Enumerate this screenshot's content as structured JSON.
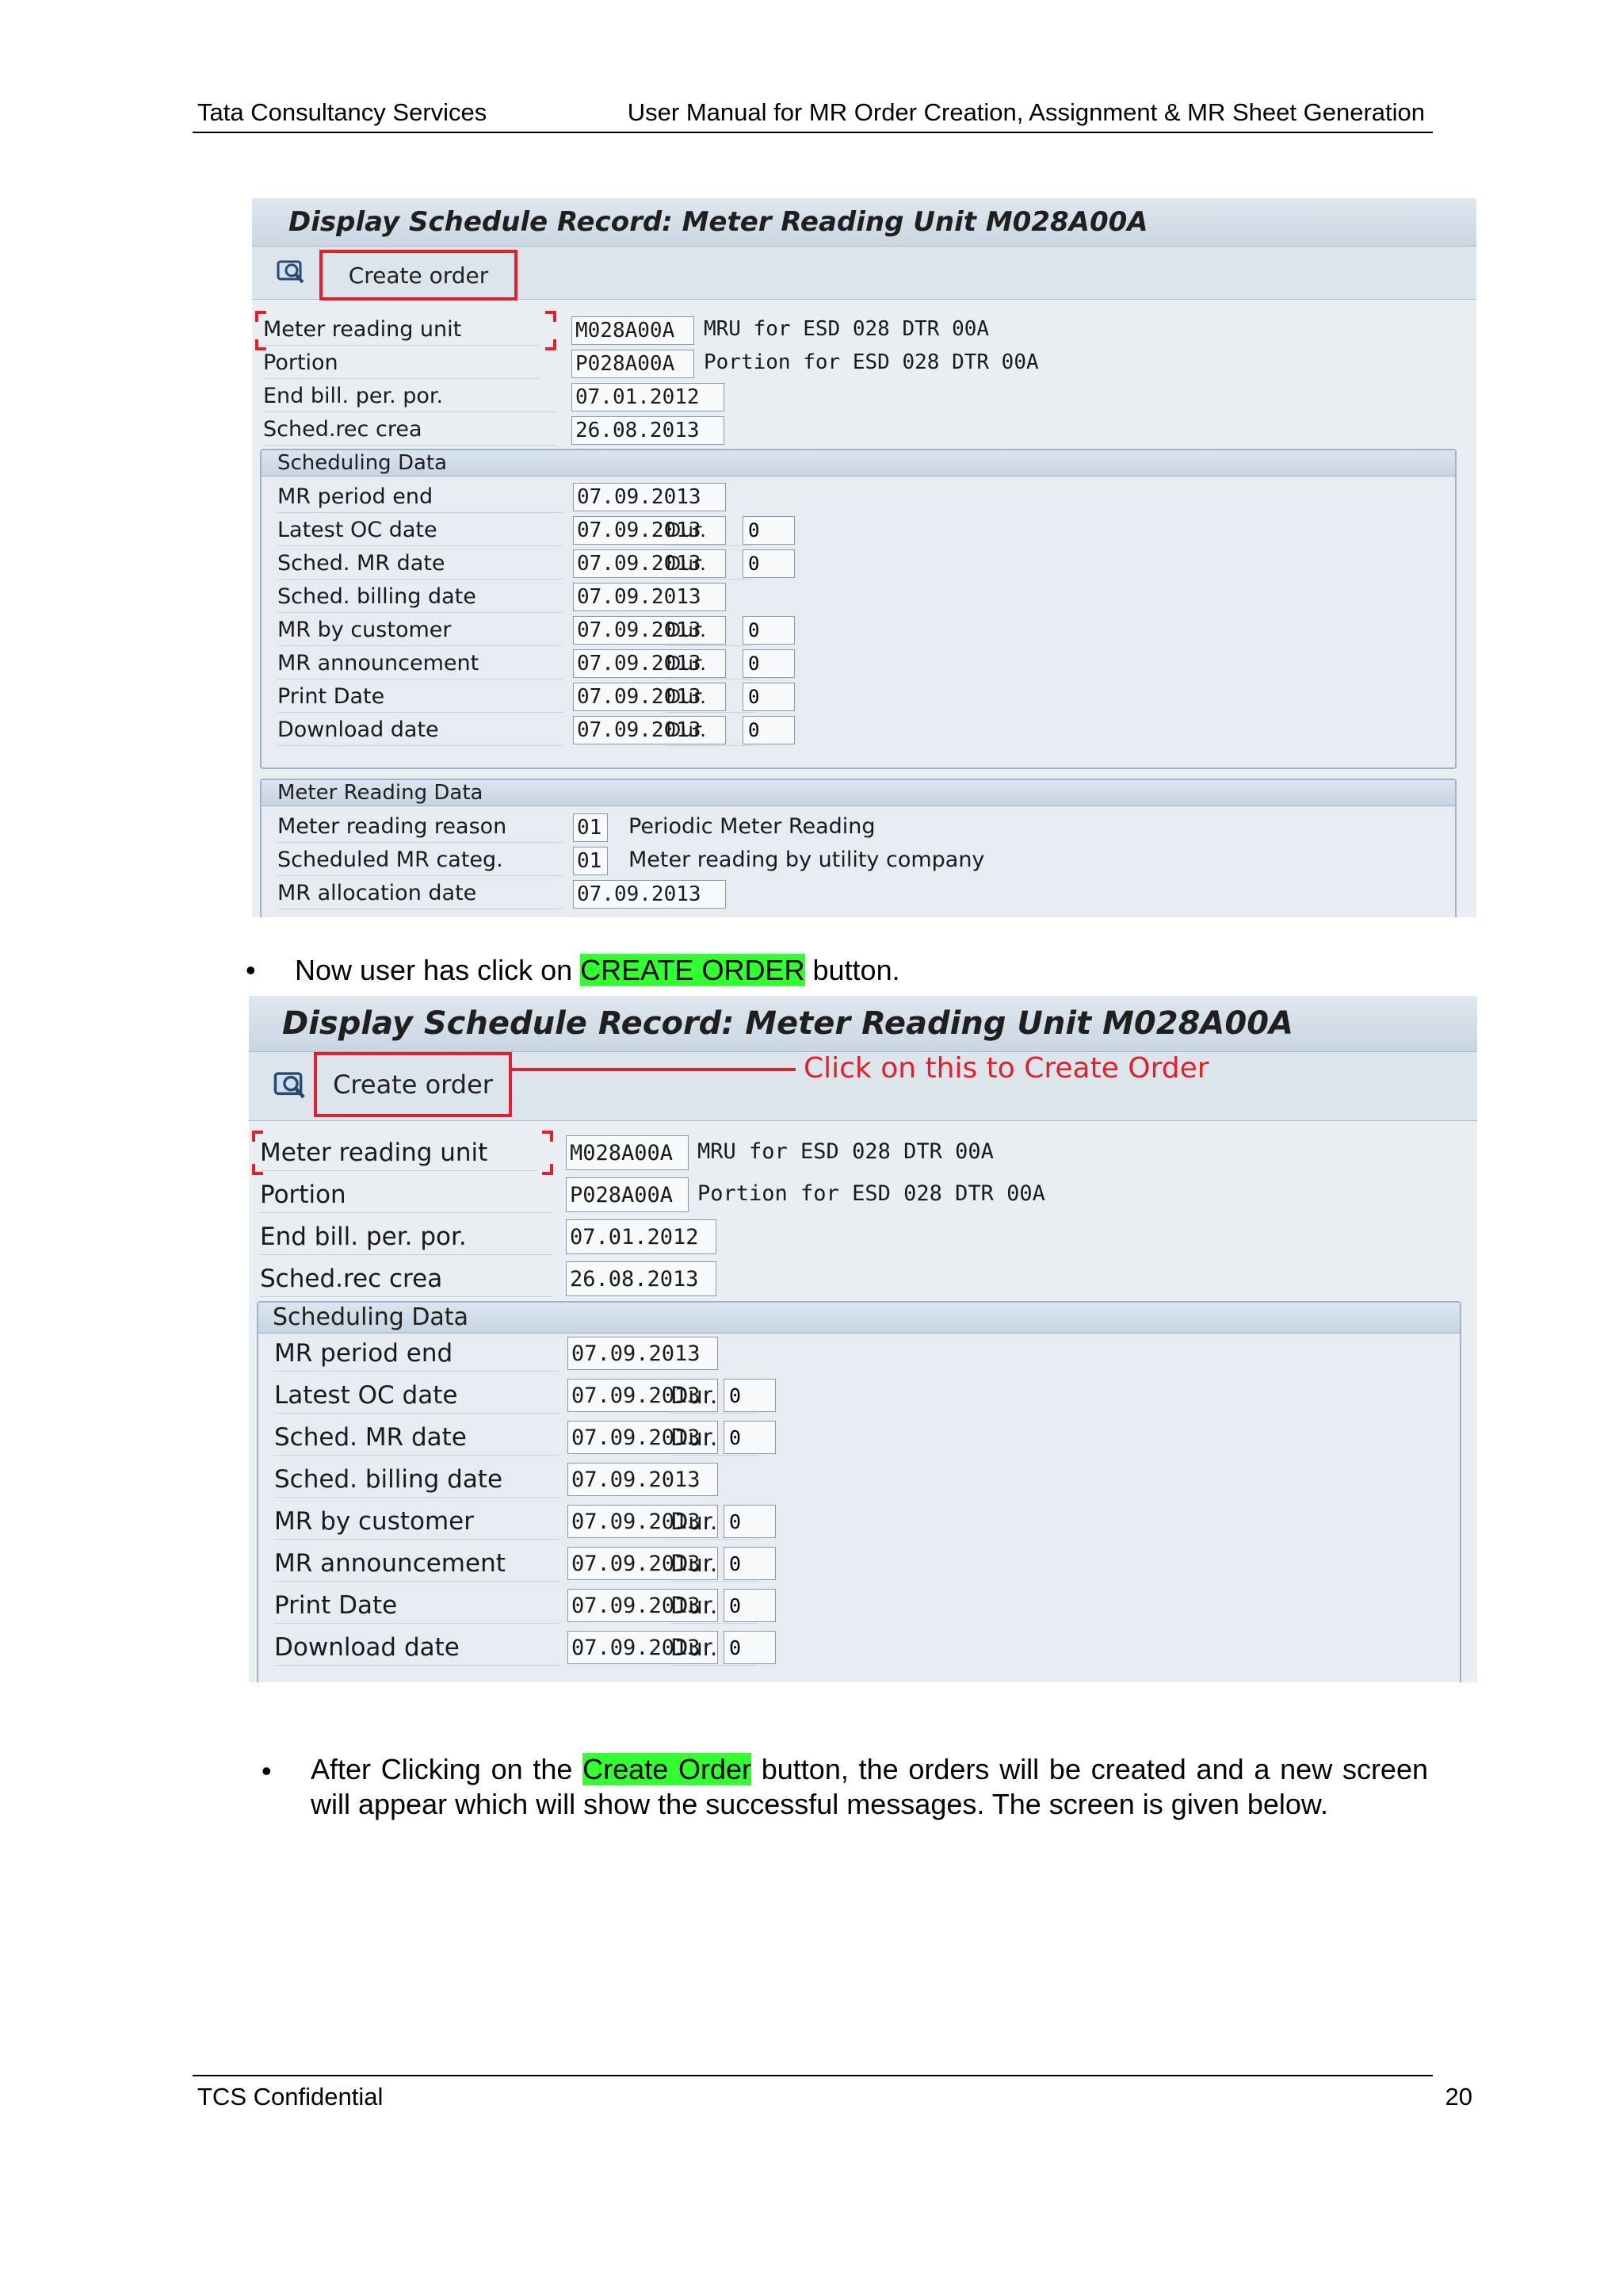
{
  "header": {
    "left": "Tata Consultancy Services",
    "right": "User Manual for MR Order Creation, Assignment & MR Sheet Generation"
  },
  "screen1": {
    "title": "Display Schedule Record: Meter Reading Unit M028A00A",
    "create_order_label": "Create order",
    "fields": {
      "mru_label": "Meter reading unit",
      "mru_value": "M028A00A",
      "mru_desc": "MRU for ESD 028 DTR 00A",
      "portion_label": "Portion",
      "portion_value": "P028A00A",
      "portion_desc": "Portion for ESD 028 DTR 00A",
      "endbill_label": "End bill. per. por.",
      "endbill_value": "07.01.2012",
      "schedrec_label": "Sched.rec crea",
      "schedrec_value": "26.08.2013"
    },
    "scheduling": {
      "title": "Scheduling Data",
      "rows": [
        {
          "label": "MR period end",
          "value": "07.09.2013",
          "dur_label": "",
          "dur_value": ""
        },
        {
          "label": "Latest OC date",
          "value": "07.09.2013",
          "dur_label": "Dur.",
          "dur_value": "0"
        },
        {
          "label": "Sched. MR date",
          "value": "07.09.2013",
          "dur_label": "Dur.",
          "dur_value": "0"
        },
        {
          "label": "Sched. billing date",
          "value": "07.09.2013",
          "dur_label": "",
          "dur_value": ""
        },
        {
          "label": "MR by customer",
          "value": "07.09.2013",
          "dur_label": "Dur.",
          "dur_value": "0"
        },
        {
          "label": "MR announcement",
          "value": "07.09.2013",
          "dur_label": "Dur.",
          "dur_value": "0"
        },
        {
          "label": "Print Date",
          "value": "07.09.2013",
          "dur_label": "Dur.",
          "dur_value": "0"
        },
        {
          "label": "Download date",
          "value": "07.09.2013",
          "dur_label": "Dur.",
          "dur_value": "0"
        }
      ]
    },
    "meter_reading": {
      "title": "Meter Reading Data",
      "rows": [
        {
          "label": "Meter reading reason",
          "value": "01",
          "desc": "Periodic Meter Reading"
        },
        {
          "label": "Scheduled MR categ.",
          "value": "01",
          "desc": "Meter reading by utility company"
        },
        {
          "label": "MR allocation date",
          "value": "07.09.2013",
          "desc": ""
        }
      ]
    }
  },
  "bullet1": {
    "before": "Now user has click on ",
    "highlight": "CREATE ORDER",
    "after": " button."
  },
  "screen2": {
    "title": "Display Schedule Record: Meter Reading Unit M028A00A",
    "create_order_label": "Create order",
    "annotation": "Click on this to Create Order",
    "fields": {
      "mru_label": "Meter reading unit",
      "mru_value": "M028A00A",
      "mru_desc": "MRU for ESD 028 DTR 00A",
      "portion_label": "Portion",
      "portion_value": "P028A00A",
      "portion_desc": "Portion for ESD 028 DTR 00A",
      "endbill_label": "End bill. per. por.",
      "endbill_value": "07.01.2012",
      "schedrec_label": "Sched.rec crea",
      "schedrec_value": "26.08.2013"
    },
    "scheduling": {
      "title": "Scheduling Data",
      "rows": [
        {
          "label": "MR period end",
          "value": "07.09.2013",
          "dur_label": "",
          "dur_value": ""
        },
        {
          "label": "Latest OC date",
          "value": "07.09.2013",
          "dur_label": "Dur.",
          "dur_value": "0"
        },
        {
          "label": "Sched. MR date",
          "value": "07.09.2013",
          "dur_label": "Dur.",
          "dur_value": "0"
        },
        {
          "label": "Sched. billing date",
          "value": "07.09.2013",
          "dur_label": "",
          "dur_value": ""
        },
        {
          "label": "MR by customer",
          "value": "07.09.2013",
          "dur_label": "Dur.",
          "dur_value": "0"
        },
        {
          "label": "MR announcement",
          "value": "07.09.2013",
          "dur_label": "Dur.",
          "dur_value": "0"
        },
        {
          "label": "Print Date",
          "value": "07.09.2013",
          "dur_label": "Dur.",
          "dur_value": "0"
        },
        {
          "label": "Download date",
          "value": "07.09.2013",
          "dur_label": "Dur.",
          "dur_value": "0"
        }
      ]
    }
  },
  "bullet2": {
    "before": "After Clicking on the ",
    "highlight": "Create Order",
    "after": " button, the orders will be created and a new screen will appear which will show the successful messages. The screen is given below."
  },
  "footer": {
    "left": "TCS Confidential",
    "page": "20"
  },
  "colors": {
    "highlight": "#33ff33",
    "annotation_red": "#e0202a"
  }
}
